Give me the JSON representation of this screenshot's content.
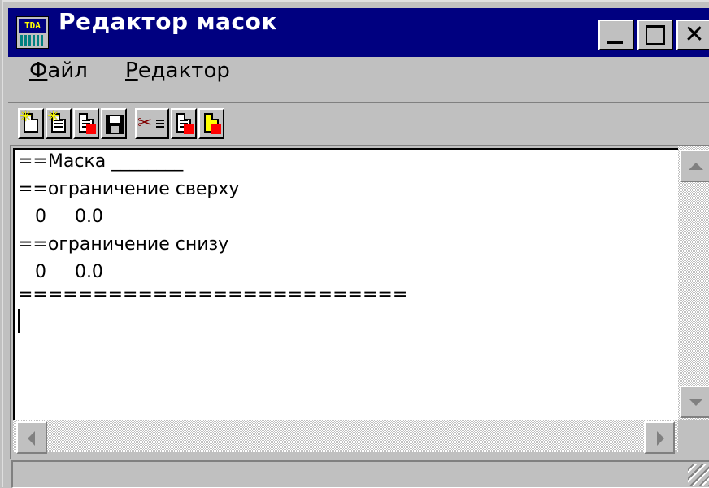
{
  "window": {
    "title": "Редактор масок",
    "icon_label": "TDA",
    "controls": {
      "minimize": "_",
      "maximize": "□",
      "close": "✕"
    }
  },
  "menu": {
    "items": [
      {
        "accel": "Ф",
        "rest": "айл"
      },
      {
        "accel": "Р",
        "rest": "едактор"
      }
    ]
  },
  "toolbar": {
    "icons": [
      "new-document-icon",
      "new-from-template-icon",
      "save-as-icon",
      "save-icon",
      "cut-icon",
      "copy-icon",
      "paste-icon"
    ]
  },
  "editor": {
    "lines": [
      "==Маска ________",
      "==ограничение сверху",
      "   0     0.0",
      "==ограничение снизу",
      "   0     0.0",
      "=========================="
    ]
  },
  "statusbar": {
    "text": ""
  }
}
